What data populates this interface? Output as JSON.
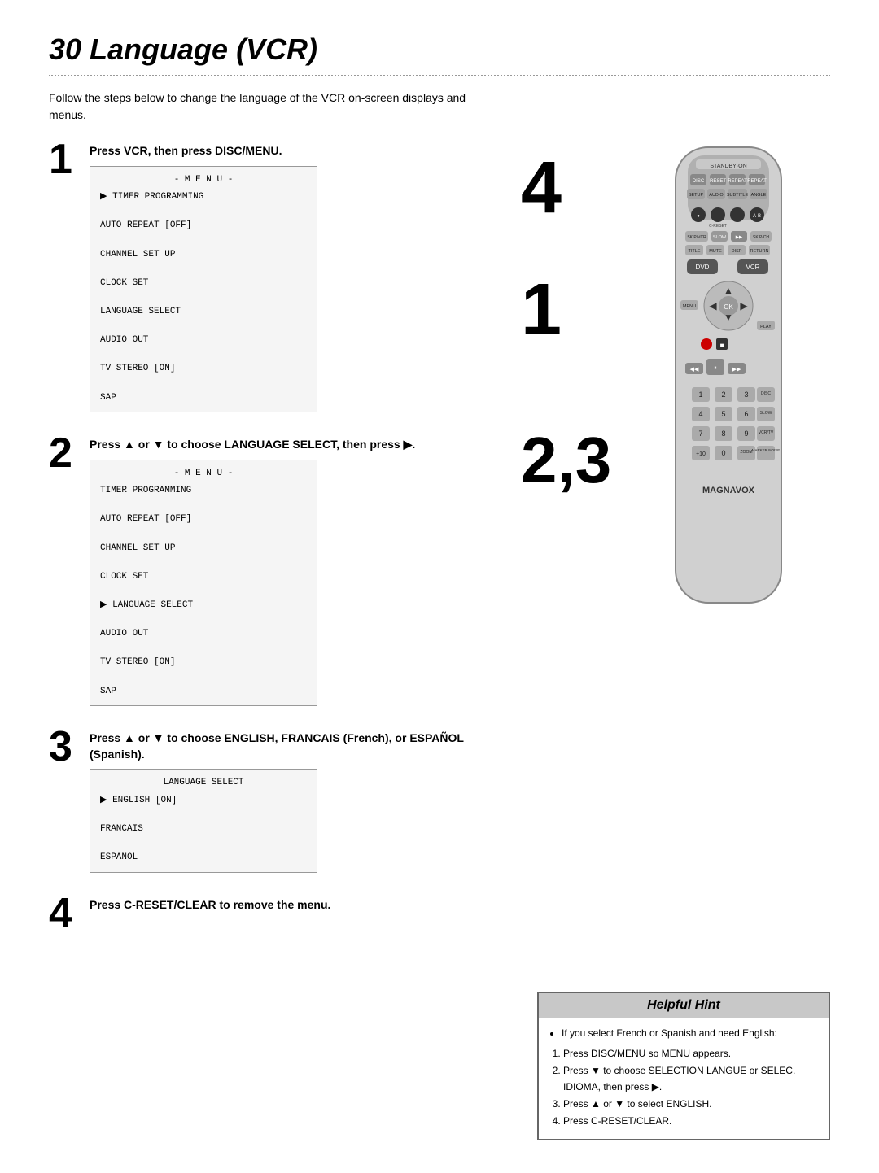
{
  "page": {
    "title": "30  Language (VCR)",
    "intro": "Follow the steps below to change the language of the VCR on-screen displays and menus."
  },
  "steps": [
    {
      "number": "1",
      "instruction": "Press VCR, then press DISC/MENU.",
      "menu": {
        "title": "- M E N U -",
        "items": [
          {
            "text": "TIMER PROGRAMMING",
            "selected": true
          },
          {
            "text": "AUTO REPEAT    [OFF]"
          },
          {
            "text": "CHANNEL SET UP"
          },
          {
            "text": "CLOCK SET"
          },
          {
            "text": "LANGUAGE SELECT"
          },
          {
            "text": "AUDIO OUT"
          },
          {
            "text": "TV STEREO       [ON]"
          },
          {
            "text": "SAP"
          }
        ]
      }
    },
    {
      "number": "2",
      "instruction": "Press ▲ or ▼ to choose LANGUAGE SELECT, then press ▶.",
      "menu": {
        "title": "- M E N U -",
        "items": [
          {
            "text": "TIMER PROGRAMMING"
          },
          {
            "text": "AUTO REPEAT    [OFF]"
          },
          {
            "text": "CHANNEL SET UP"
          },
          {
            "text": "CLOCK SET"
          },
          {
            "text": "LANGUAGE SELECT",
            "selected": true
          },
          {
            "text": "AUDIO OUT"
          },
          {
            "text": "TV STEREO       [ON]"
          },
          {
            "text": "SAP"
          }
        ]
      }
    },
    {
      "number": "3",
      "instruction": "Press ▲ or ▼ to choose ENGLISH, FRANCAIS (French), or ESPAÑOL (Spanish).",
      "menu": {
        "title": "LANGUAGE SELECT",
        "items": [
          {
            "text": "ENGLISH         [ON]",
            "selected": true
          },
          {
            "text": "FRANCAIS"
          },
          {
            "text": "ESPAÑOL"
          }
        ]
      }
    },
    {
      "number": "4",
      "instruction": "Press C-RESET/CLEAR to remove the menu."
    }
  ],
  "hint": {
    "title": "Helpful Hint",
    "bullet": "If you select French or Spanish and need English:",
    "items": [
      "Press DISC/MENU so MENU appears.",
      "Press ▼ to choose SELECTION LANGUE or SELEC. IDIOMA, then press ▶.",
      "Press ▲ or ▼ to select ENGLISH.",
      "Press C-RESET/CLEAR."
    ]
  },
  "big_numbers": {
    "n4": "4",
    "n1": "1",
    "n23": "2,3"
  }
}
